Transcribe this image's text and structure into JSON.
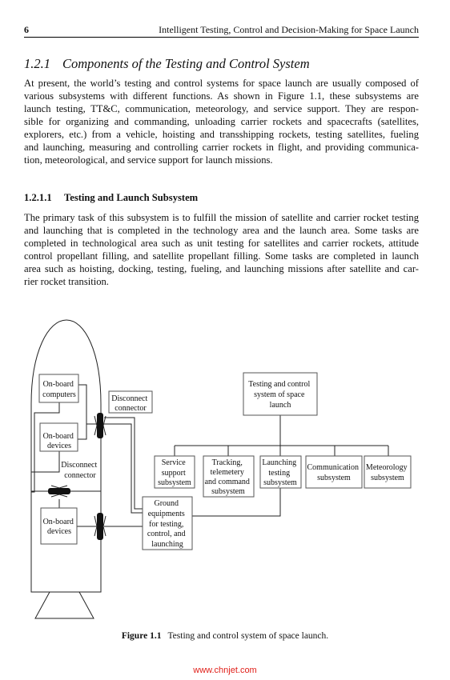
{
  "header": {
    "page_number": "6",
    "running_title": "Intelligent Testing, Control and Decision-Making for Space Launch"
  },
  "section": {
    "number": "1.2.1",
    "title": "Components of the Testing and Control System"
  },
  "paragraph1": {
    "lines": [
      "At present, the world’s testing and control systems for space launch are usually composed of",
      "various subsystems with different functions. As shown in Figure 1.1, these subsystems are",
      "launch testing, TT&C, communication, meteorology, and service support. They are respon-",
      "sible for organizing and commanding, unloading carrier rockets and spacecrafts (satellites,",
      "explorers, etc.) from a vehicle, hoisting and transshipping rockets, testing satellites, fueling",
      "and launching, measuring and controlling carrier rockets in flight, and providing communica-",
      "tion, meteorological, and service support for launch missions."
    ]
  },
  "subsection": {
    "number": "1.2.1.1",
    "title": "Testing and Launch Subsystem"
  },
  "paragraph2": {
    "lines": [
      "The primary task of this subsystem is to fulfill the mission of satellite and carrier rocket testing",
      "and launching that is completed in the technology area and the launch area. Some tasks are",
      "completed in technological area such as unit testing for satellites and carrier rockets, attitude",
      "control propellant filling, and satellite propellant filling. Some tasks are completed in launch",
      "area such as hoisting, docking, testing, fueling, and launching missions after satellite and car-",
      "rier rocket transition."
    ]
  },
  "figure": {
    "rocket": {
      "onboard_computers": [
        "On-board",
        "computers"
      ],
      "onboard_devices_upper": [
        "On-board",
        "devices"
      ],
      "onboard_devices_lower": [
        "On-board",
        "devices"
      ],
      "disconnect_internal": [
        "Disconnect",
        "connector"
      ]
    },
    "disconnect_external": [
      "Disconnect",
      "connector"
    ],
    "root": [
      "Testing and control",
      "system of space",
      "launch"
    ],
    "subsystems": [
      [
        "Service",
        "support",
        "subsystem"
      ],
      [
        "Tracking,",
        "telemetery",
        "and command",
        "subsystem"
      ],
      [
        "Launching",
        "testing",
        "subsystem"
      ],
      [
        "Communication",
        "subsystem"
      ],
      [
        "Meteorology",
        "subsystem"
      ]
    ],
    "ground": [
      "Ground",
      "equipments",
      "for testing,",
      "control, and",
      "launching"
    ]
  },
  "caption": {
    "label": "Figure 1.1",
    "text": "Testing and control system of space launch."
  },
  "watermark": "www.chnjet.com"
}
